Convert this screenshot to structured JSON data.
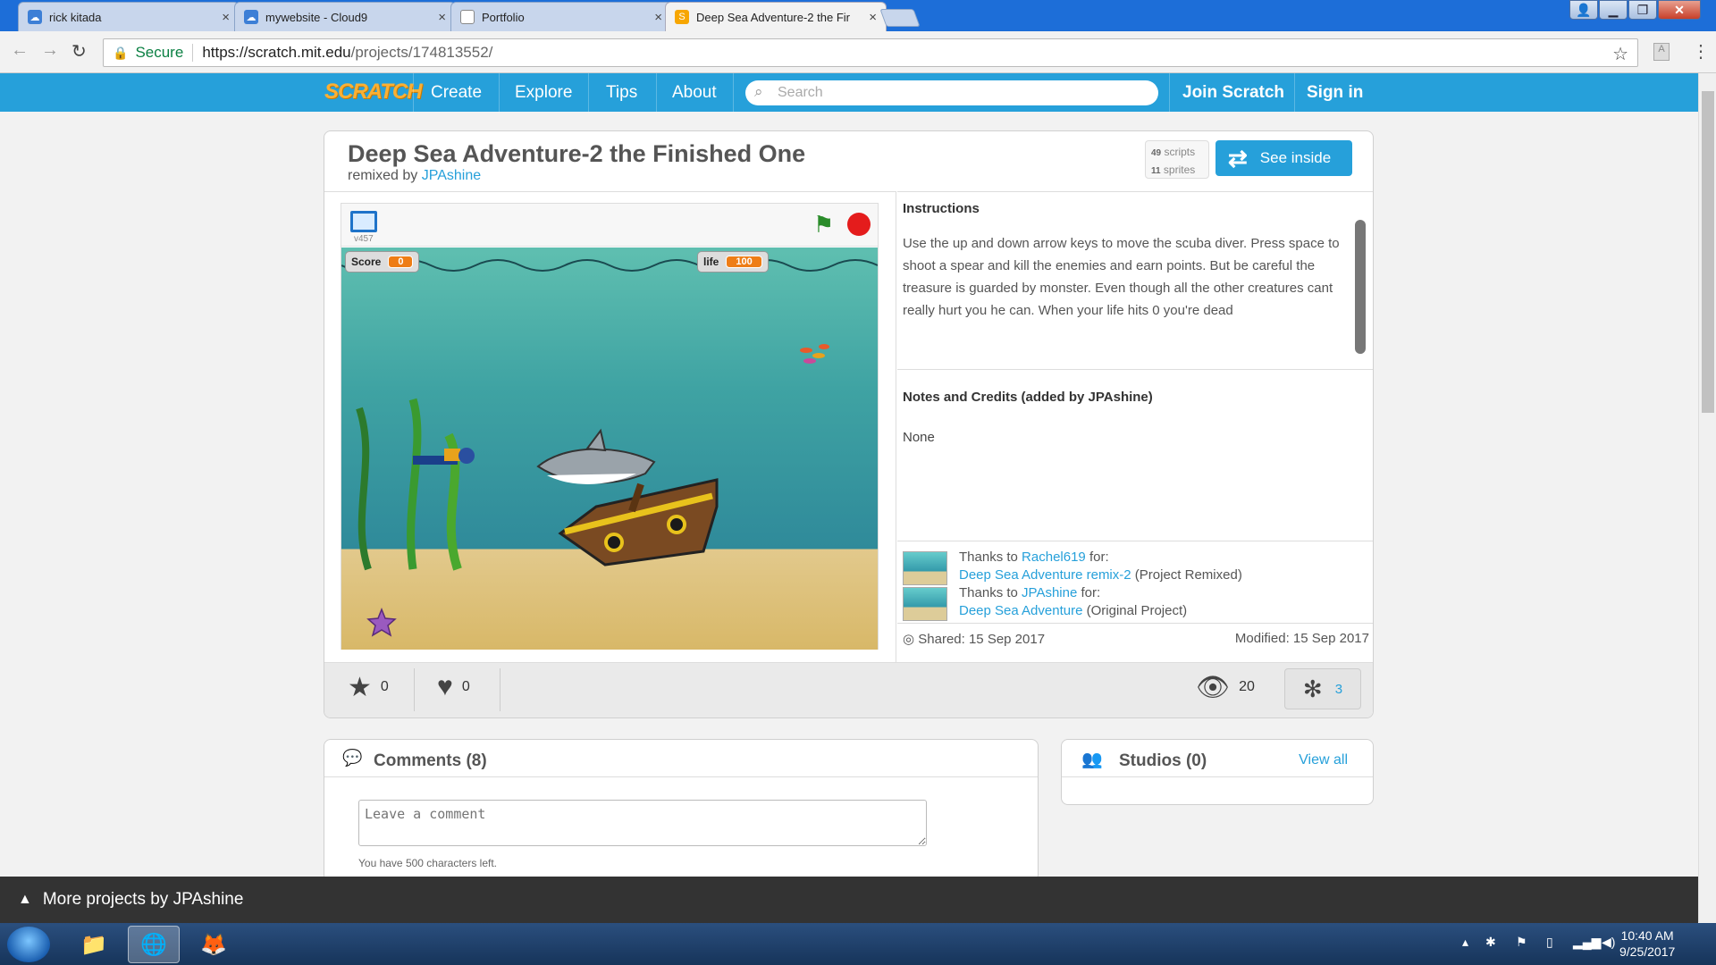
{
  "browser": {
    "tabs": [
      {
        "label": "rick kitada",
        "favicon": "cloud9-icon"
      },
      {
        "label": "mywebsite - Cloud9",
        "favicon": "cloud9-icon"
      },
      {
        "label": "Portfolio",
        "favicon": "page-icon"
      },
      {
        "label": "Deep Sea Adventure-2 the Fir",
        "favicon": "scratch-icon"
      }
    ],
    "secure_label": "Secure",
    "url_host": "https://scratch.mit.edu",
    "url_path": "/projects/174813552/"
  },
  "scratch_nav": {
    "logo": "SCRATCH",
    "links": [
      "Create",
      "Explore",
      "Tips",
      "About"
    ],
    "search_placeholder": "Search",
    "join": "Join Scratch",
    "sign_in": "Sign in"
  },
  "project": {
    "title": "Deep Sea Adventure-2 the Finished One",
    "remixed_by_prefix": "remixed by",
    "author": "JPAshine",
    "scripts_count": "49",
    "scripts_label": "scripts",
    "sprites_count": "11",
    "sprites_label": "sprites",
    "see_inside": "See inside",
    "version": "v457",
    "monitors": {
      "score_label": "Score",
      "score_value": "0",
      "life_label": "life",
      "life_value": "100"
    },
    "instructions_heading": "Instructions",
    "instructions_text": "Use the up and down arrow keys to move the scuba diver. Press space to shoot a spear and kill the enemies and earn points. But be careful the treasure is guarded by monster. Even though all the other creatures cant really hurt you he can. When your life hits 0 you're dead",
    "notes_heading": "Notes and Credits (added by JPAshine)",
    "notes_text": "None",
    "credits": [
      {
        "thanks_to": "Thanks to",
        "user": "Rachel619",
        "for": "for:",
        "project": "Deep Sea Adventure remix-2",
        "kind": "(Project Remixed)"
      },
      {
        "thanks_to": "Thanks to",
        "user": "JPAshine",
        "for": "for:",
        "project": "Deep Sea Adventure",
        "kind": "(Original Project)"
      }
    ],
    "shared": "Shared: 15 Sep 2017",
    "modified": "Modified: 15 Sep 2017",
    "favorites": "0",
    "loves": "0",
    "views": "20",
    "remixes": "3"
  },
  "comments": {
    "title": "Comments (8)",
    "placeholder": "Leave a comment",
    "chars_left": "You have 500 characters left."
  },
  "studios": {
    "title": "Studios (0)",
    "view_all": "View all"
  },
  "footer": {
    "more_projects": "More projects by JPAshine"
  },
  "taskbar": {
    "time": "10:40 AM",
    "date": "9/25/2017"
  },
  "colors": {
    "scratch_blue": "#26a0da",
    "titlebar_blue": "#1d6ed8",
    "monitor_orange": "#ee7d16"
  }
}
